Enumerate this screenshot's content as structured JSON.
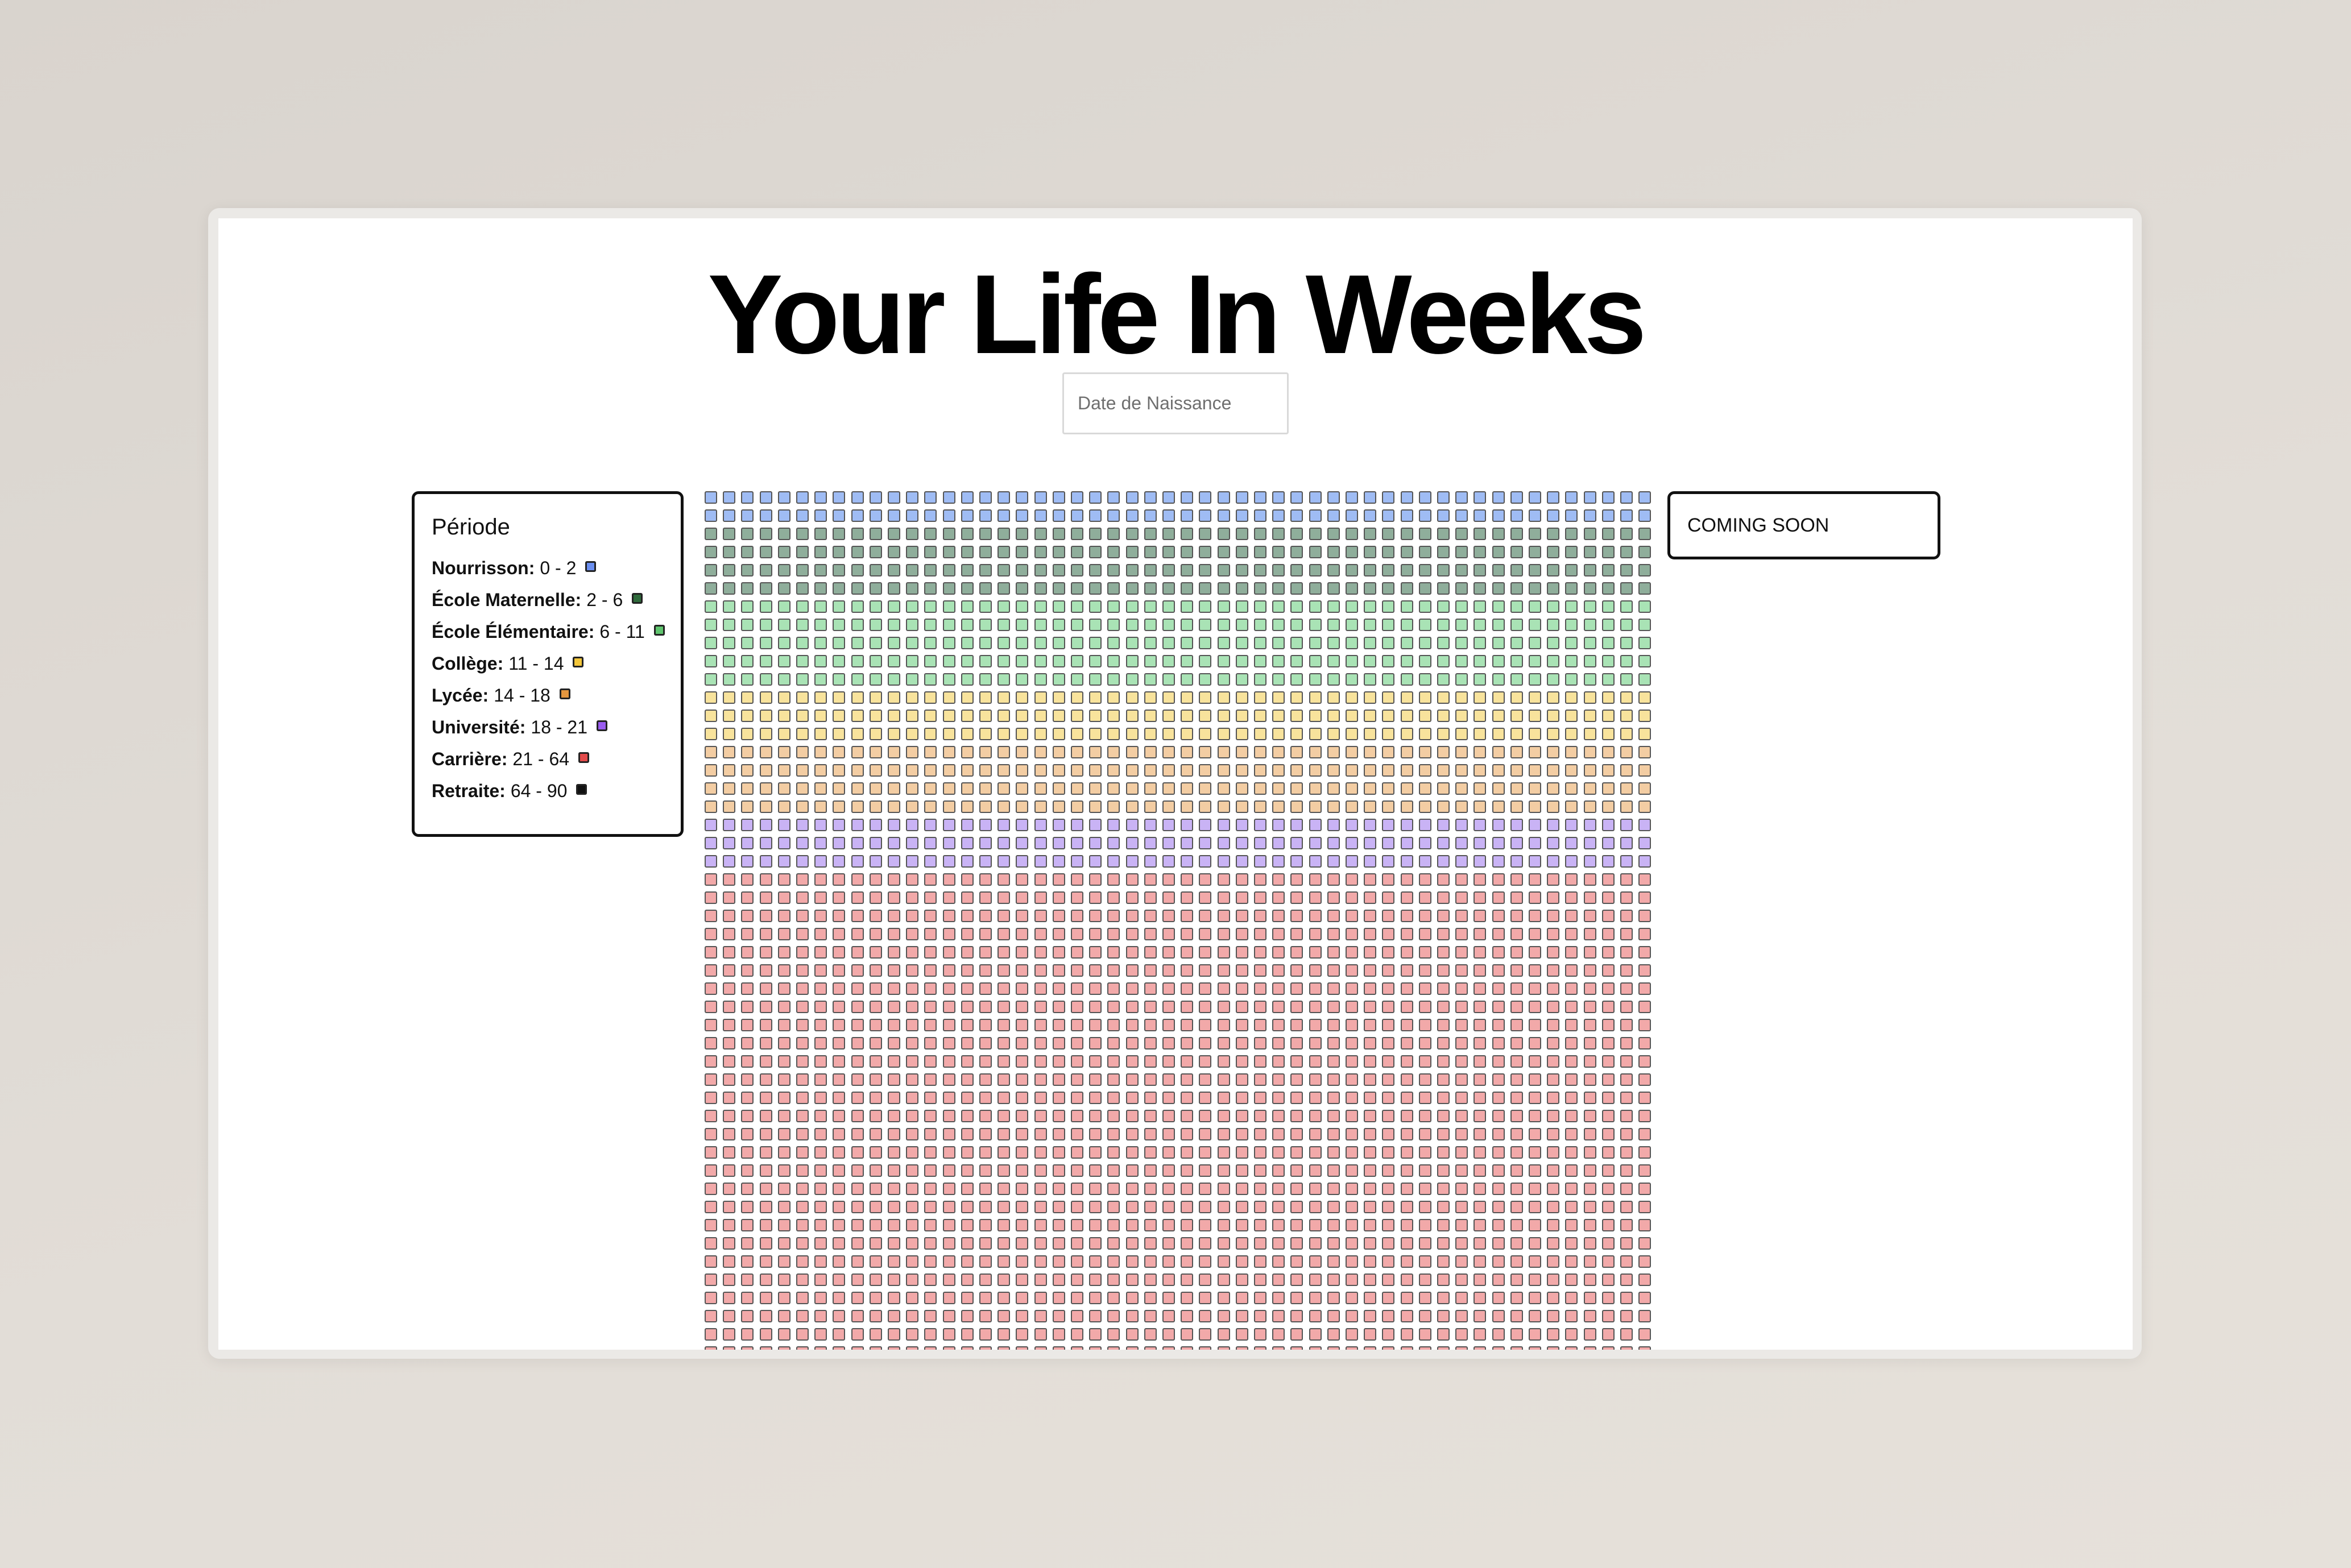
{
  "app": {
    "title": "Your Life In Weeks"
  },
  "birth_input": {
    "placeholder": "Date de Naissance",
    "value": ""
  },
  "legend": {
    "title": "Période",
    "items": [
      {
        "label": "Nourrisson:",
        "range": "0 - 2",
        "color": "#6b8ff0"
      },
      {
        "label": "École Maternelle:",
        "range": "2 - 6",
        "color": "#2f6b3c"
      },
      {
        "label": "École Élémentaire:",
        "range": "6 - 11",
        "color": "#5fc46e"
      },
      {
        "label": "Collège:",
        "range": "11 - 14",
        "color": "#f3c63a"
      },
      {
        "label": "Lycée:",
        "range": "14 - 18",
        "color": "#e3963f"
      },
      {
        "label": "Université:",
        "range": "18 - 21",
        "color": "#9a5cf0"
      },
      {
        "label": "Carrière:",
        "range": "21 - 64",
        "color": "#e34b4b"
      },
      {
        "label": "Retraite:",
        "range": "64 - 90",
        "color": "#111111"
      }
    ]
  },
  "coming_soon": {
    "label": "COMING SOON"
  },
  "weeks_grid": {
    "weeks_per_row": 52,
    "rows_visible": 48,
    "periods": [
      {
        "name": "Nourrisson",
        "rows": 2,
        "fill": "#9fbcf4"
      },
      {
        "name": "École Maternelle",
        "rows": 4,
        "fill": "#8fae9b"
      },
      {
        "name": "École Élémentaire",
        "rows": 5,
        "fill": "#a9e3b5"
      },
      {
        "name": "Collège",
        "rows": 3,
        "fill": "#f8e39c"
      },
      {
        "name": "Lycée",
        "rows": 4,
        "fill": "#f3cda3"
      },
      {
        "name": "Université",
        "rows": 3,
        "fill": "#c9b3f5"
      },
      {
        "name": "Carrière",
        "rows": 27,
        "fill": "#f2a9a9"
      }
    ]
  }
}
